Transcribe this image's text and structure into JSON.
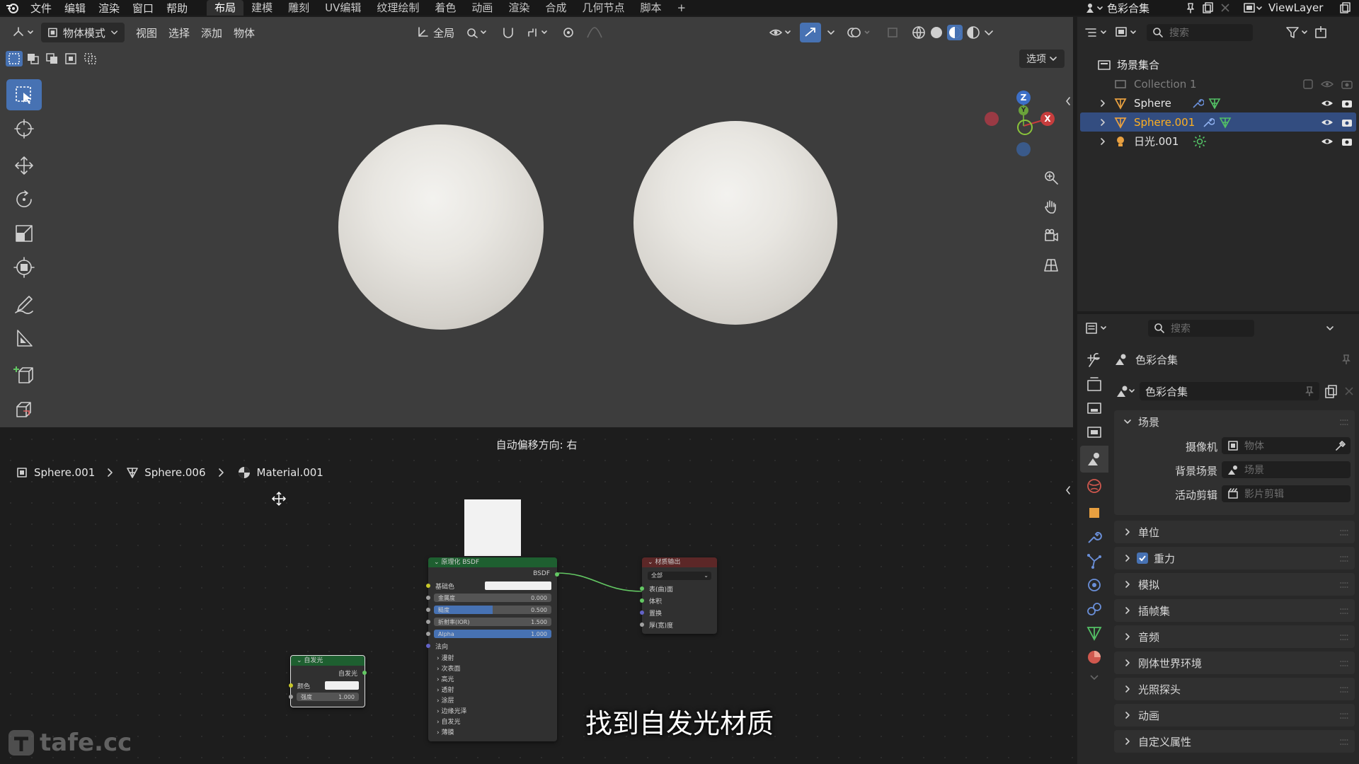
{
  "topbar": {
    "menus": [
      "文件",
      "编辑",
      "渲染",
      "窗口",
      "帮助"
    ],
    "workspaces": [
      "布局",
      "建模",
      "雕刻",
      "UV编辑",
      "纹理绘制",
      "着色",
      "动画",
      "渲染",
      "合成",
      "几何节点",
      "脚本"
    ],
    "active_workspace": "布局",
    "add_tab": "+",
    "scene_name": "色彩合集",
    "view_layer": "ViewLayer"
  },
  "viewport": {
    "mode": "物体模式",
    "menus": [
      "视图",
      "选择",
      "添加",
      "物体"
    ],
    "transform_orientation": "全局",
    "options_label": "选项",
    "gizmo": {
      "z": "Z",
      "y": "Y",
      "x": "X"
    }
  },
  "node_editor": {
    "status_text": "自动偏移方向: 右",
    "breadcrumb": [
      "Sphere.001",
      "Sphere.006",
      "Material.001"
    ],
    "bsdf_node": {
      "title": "原理化 BSDF",
      "output": "BSDF",
      "base_color": "基础色",
      "metallic": {
        "label": "金属度",
        "value": "0.000"
      },
      "roughness": {
        "label": "糙度",
        "value": "0.500",
        "fill": 0.5
      },
      "ior": {
        "label": "折射率(IOR)",
        "value": "1.500"
      },
      "alpha": {
        "label": "Alpha",
        "value": "1.000",
        "fill": 1.0
      },
      "normal": "法向",
      "subpanels": [
        "漫射",
        "次表面",
        "高光",
        "透射",
        "涂层",
        "边缘光泽",
        "自发光",
        "薄膜"
      ]
    },
    "output_node": {
      "title": "材质输出",
      "target": "全部",
      "inputs": [
        "表(曲)面",
        "体积",
        "置换",
        "厚(宽)度"
      ]
    },
    "emission_node": {
      "title": "自发光",
      "output": "自发光",
      "color_label": "颜色",
      "strength_label": "强度",
      "strength_value": "1.000"
    },
    "subtitle": "找到自发光材质",
    "watermark": "tafe.cc"
  },
  "outliner": {
    "search_placeholder": "搜索",
    "scene_collection": "场景集合",
    "items": [
      {
        "name": "Collection 1",
        "dim": true
      },
      {
        "name": "Sphere",
        "selected": false
      },
      {
        "name": "Sphere.001",
        "selected": true
      },
      {
        "name": "日光.001",
        "selected": false
      }
    ]
  },
  "properties": {
    "search_placeholder": "搜索",
    "context_title": "色彩合集",
    "scene_field": "色彩合集",
    "scene_panel": "场景",
    "fields": [
      {
        "label": "摄像机",
        "value": "物体"
      },
      {
        "label": "背景场景",
        "value": "场景"
      },
      {
        "label": "活动剪辑",
        "value": "影片剪辑"
      }
    ],
    "panels": [
      "单位",
      "重力",
      "模拟",
      "插帧集",
      "音频",
      "刚体世界环境",
      "光照探头",
      "动画",
      "自定义属性"
    ],
    "gravity_checked": true
  },
  "colors": {
    "accent": "#4772b3",
    "selected_row": "#334d80",
    "node_green": "#1e5f30",
    "node_red": "#5c2727",
    "shader_socket": "#63c763",
    "color_socket": "#c7c729",
    "float_socket": "#a1a1a1",
    "vector_socket": "#6363c7"
  }
}
